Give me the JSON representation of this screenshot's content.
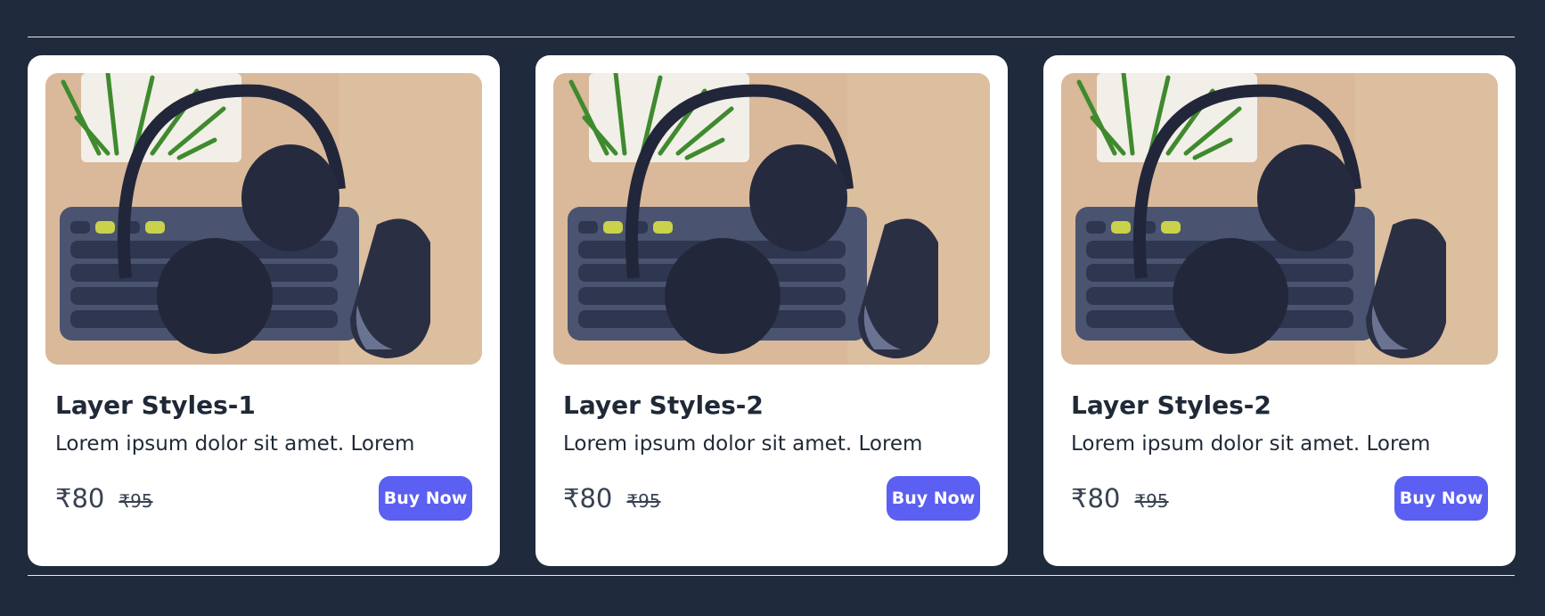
{
  "colors": {
    "background": "#1f2a3c",
    "card": "#ffffff",
    "accent": "#5b5ff2",
    "text": "#1f2937"
  },
  "cards": [
    {
      "title": "Layer Styles-1",
      "description": "Lorem ipsum dolor sit amet. Lorem",
      "price": "₹80",
      "old_price": "₹95",
      "button_label": "Buy Now"
    },
    {
      "title": "Layer Styles-2",
      "description": "Lorem ipsum dolor sit amet. Lorem",
      "price": "₹80",
      "old_price": "₹95",
      "button_label": "Buy Now"
    },
    {
      "title": "Layer Styles-2",
      "description": "Lorem ipsum dolor sit amet. Lorem",
      "price": "₹80",
      "old_price": "₹95",
      "button_label": "Buy Now"
    }
  ]
}
